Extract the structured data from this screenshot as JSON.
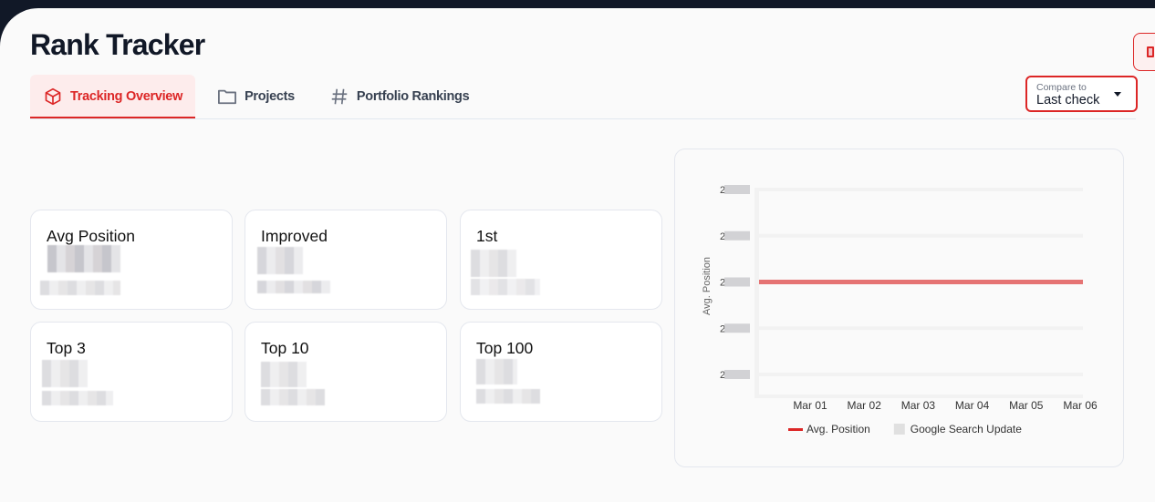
{
  "app": {
    "title": "Rank Tracker"
  },
  "tabs": [
    {
      "label": "Tracking Overview",
      "icon": "cube-icon",
      "active": true
    },
    {
      "label": "Projects",
      "icon": "folder-icon",
      "active": false
    },
    {
      "label": "Portfolio Rankings",
      "icon": "hash-icon",
      "active": false
    }
  ],
  "compare": {
    "label": "Compare to",
    "value": "Last check"
  },
  "colors": {
    "accent": "#dc2626",
    "line": "#e57373",
    "dark": "#111827"
  },
  "metrics": [
    {
      "label": "Avg Position",
      "value": "[redacted]"
    },
    {
      "label": "Improved",
      "value": "[redacted]"
    },
    {
      "label": "1st",
      "value": "[redacted]"
    },
    {
      "label": "Top 3",
      "value": "[redacted]"
    },
    {
      "label": "Top 10",
      "value": "[redacted]"
    },
    {
      "label": "Top 100",
      "value": "[redacted]"
    }
  ],
  "chart_data": {
    "type": "line",
    "title": "",
    "xlabel": "",
    "ylabel": "Avg. Position",
    "x": [
      "Mar 01",
      "Mar 02",
      "Mar 03",
      "Mar 04",
      "Mar 05",
      "Mar 06"
    ],
    "y_ticks": [
      "[redacted]",
      "[redacted]",
      "[redacted]",
      "[redacted]",
      "[redacted]"
    ],
    "ylim_index": [
      0,
      4
    ],
    "series": [
      {
        "name": "Avg. Position",
        "color": "#e57373",
        "values_tick_index": [
          2,
          2,
          2,
          2,
          2,
          2
        ]
      }
    ],
    "legend": [
      {
        "name": "Avg. Position",
        "kind": "line",
        "color": "#dc2626"
      },
      {
        "name": "Google Search Update",
        "kind": "box",
        "color": "#e0e0e0"
      }
    ],
    "legend_position": "bottom",
    "grid": true
  }
}
